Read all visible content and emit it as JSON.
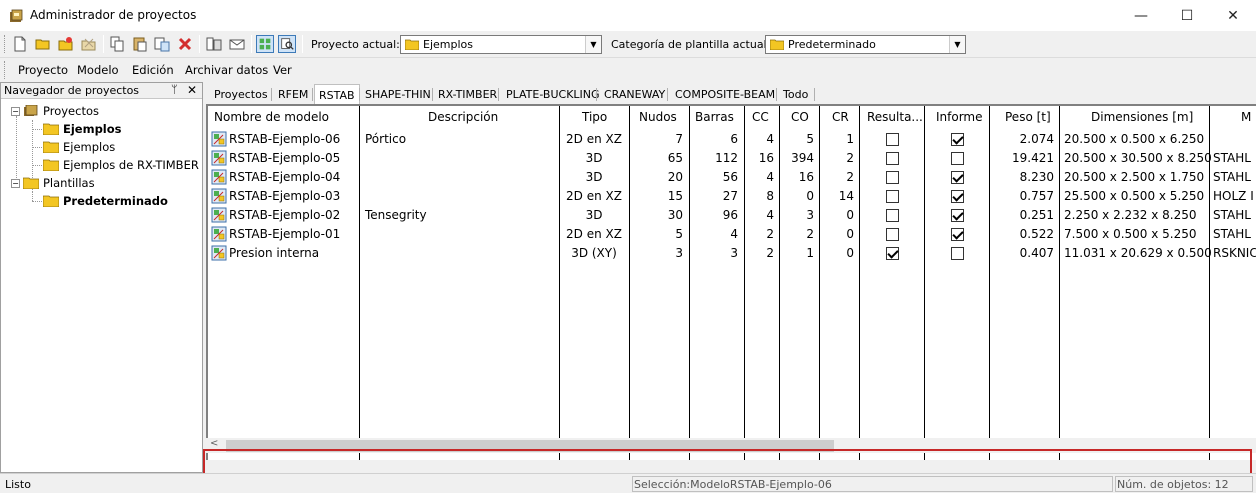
{
  "window": {
    "title": "Administrador de proyectos",
    "controls": {
      "minimize": "—",
      "maximize": "☐",
      "close": "✕"
    }
  },
  "toolbar": {
    "current_project_label": "Proyecto actual:",
    "current_project_value": "Ejemplos",
    "template_category_label": "Categoría de plantilla actual",
    "template_category_value": "Predeterminado"
  },
  "menu": [
    "Proyecto",
    "Modelo",
    "Edición",
    "Archivar datos",
    "Ver"
  ],
  "navigator": {
    "title": "Navegador de proyectos",
    "pin": "ᛘ",
    "close": "✕",
    "tree": [
      {
        "label": "Proyectos",
        "level": 0,
        "bold": false,
        "twisty": "−"
      },
      {
        "label": "Ejemplos",
        "level": 1,
        "bold": true
      },
      {
        "label": "Ejemplos",
        "level": 1,
        "bold": false
      },
      {
        "label": "Ejemplos de RX-TIMBER",
        "level": 1,
        "bold": false
      },
      {
        "label": "Plantillas",
        "level": 0,
        "bold": false,
        "twisty": "−"
      },
      {
        "label": "Predeterminado",
        "level": 1,
        "bold": true
      }
    ]
  },
  "tabs": [
    "Proyectos",
    "RFEM",
    "RSTAB",
    "SHAPE-THIN",
    "RX-TIMBER",
    "PLATE-BUCKLING",
    "CRANEWAY",
    "COMPOSITE-BEAM",
    "Todo"
  ],
  "active_tab": "RSTAB",
  "table": {
    "headers": {
      "name": "Nombre de modelo",
      "desc": "Descripción",
      "type": "Tipo",
      "nodes": "Nudos",
      "bars": "Barras",
      "cc": "CC",
      "co": "CO",
      "cr": "CR",
      "results": "Resulta...",
      "report": "Informe",
      "weight": "Peso [t]",
      "dims": "Dimensiones [m]",
      "mat": "M"
    },
    "rows": [
      {
        "name": "RSTAB-Ejemplo-06",
        "desc": "Pórtico",
        "type": "2D en XZ",
        "nodes": "7",
        "bars": "6",
        "cc": "4",
        "co": "5",
        "cr": "1",
        "results": false,
        "report": true,
        "weight": "2.074",
        "dims": "20.500 x 0.500 x 6.250",
        "mat": ""
      },
      {
        "name": "RSTAB-Ejemplo-05",
        "desc": "",
        "type": "3D",
        "nodes": "65",
        "bars": "112",
        "cc": "16",
        "co": "394",
        "cr": "2",
        "results": false,
        "report": false,
        "weight": "19.421",
        "dims": "20.500 x 30.500 x 8.250",
        "mat": "STAHL"
      },
      {
        "name": "RSTAB-Ejemplo-04",
        "desc": "",
        "type": "3D",
        "nodes": "20",
        "bars": "56",
        "cc": "4",
        "co": "16",
        "cr": "2",
        "results": false,
        "report": true,
        "weight": "8.230",
        "dims": "20.500 x 2.500 x 1.750",
        "mat": "STAHL"
      },
      {
        "name": "RSTAB-Ejemplo-03",
        "desc": "",
        "type": "2D en XZ",
        "nodes": "15",
        "bars": "27",
        "cc": "8",
        "co": "0",
        "cr": "14",
        "results": false,
        "report": true,
        "weight": "0.757",
        "dims": "25.500 x 0.500 x 5.250",
        "mat": "HOLZ I"
      },
      {
        "name": "RSTAB-Ejemplo-02",
        "desc": "Tensegrity",
        "type": "3D",
        "nodes": "30",
        "bars": "96",
        "cc": "4",
        "co": "3",
        "cr": "0",
        "results": false,
        "report": true,
        "weight": "0.251",
        "dims": "2.250 x 2.232 x 8.250",
        "mat": "STAHL"
      },
      {
        "name": "RSTAB-Ejemplo-01",
        "desc": "",
        "type": "2D en XZ",
        "nodes": "5",
        "bars": "4",
        "cc": "2",
        "co": "2",
        "cr": "0",
        "results": false,
        "report": true,
        "weight": "0.522",
        "dims": "7.500 x 0.500 x 5.250",
        "mat": "STAHL"
      },
      {
        "name": "Presion interna",
        "desc": "",
        "type": "3D (XY)",
        "nodes": "3",
        "bars": "3",
        "cc": "2",
        "co": "1",
        "cr": "0",
        "results": true,
        "report": false,
        "weight": "0.407",
        "dims": "11.031 x 20.629 x 0.500",
        "mat": "RSKNIC"
      }
    ]
  },
  "status": {
    "ready": "Listo",
    "selection": "Selección:ModeloRSTAB-Ejemplo-06",
    "object_count": "Núm. de objetos: 12"
  },
  "colors": {
    "highlight_border": "#c62828",
    "folder_yellow": "#f3c623"
  }
}
